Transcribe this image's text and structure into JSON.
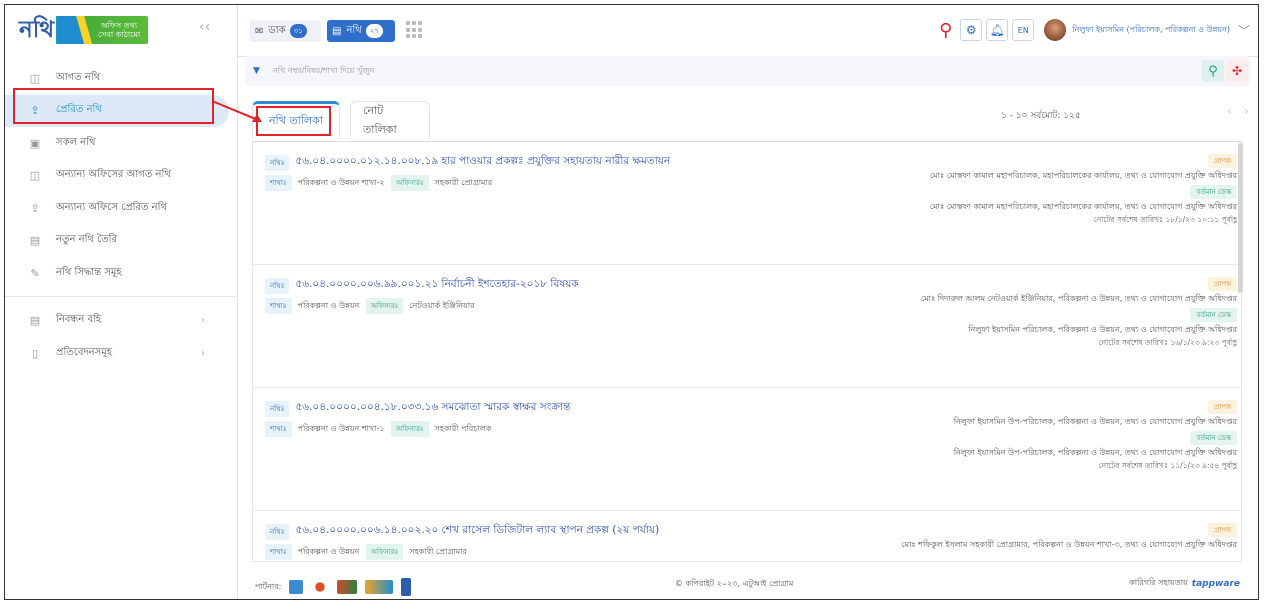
{
  "app": {
    "logo_main": "নথি",
    "logo_sub": "অফিস তথ্য\nসেবা কাঠামো",
    "collapse_icon": "chevrons-left-icon"
  },
  "sidebar": {
    "items": [
      {
        "label": "আগত নথি",
        "icon": "inbox-icon"
      },
      {
        "label": "প্রেরিত নথি",
        "icon": "upload-icon",
        "active": true
      },
      {
        "label": "সকল নথি",
        "icon": "briefcase-icon"
      },
      {
        "label": "অন্যান্য অফিসের আগত নথি",
        "icon": "inbox-icon"
      },
      {
        "label": "অন্যান্য অফিসে প্রেরিত নথি",
        "icon": "upload-icon"
      },
      {
        "label": "নতুন নথি তৈরি",
        "icon": "new-file-icon"
      },
      {
        "label": "নথি সিদ্ধান্ত সমূহ",
        "icon": "pin-icon"
      }
    ],
    "bottom_items": [
      {
        "label": "নিবন্ধন বহি",
        "icon": "register-icon"
      },
      {
        "label": "প্রতিবেদনসমূহ",
        "icon": "report-icon"
      }
    ]
  },
  "topbar": {
    "dak_label": "ডাক",
    "dak_count": "৩১",
    "nothi_label": "নথি",
    "nothi_count": "২৭",
    "lang_label": "EN",
    "user_name": "নিলুফা ইয়াসমিন (পরিচালক, পরিকল্পনা ও উন্নয়ন)"
  },
  "search": {
    "placeholder": "নথি নম্বর/বিষয়/শাখা দিয়ে খুঁজুন"
  },
  "tabs": [
    {
      "label": "নথি তালিকা",
      "active": true
    },
    {
      "label": "নোট তালিকা"
    }
  ],
  "pagination": {
    "text": "১ - ১০ সর্বমোট: ১২৫"
  },
  "labels": {
    "nothi_tag": "নথিঃ",
    "branch_tag": "শাখাঃ",
    "desk_tag": "অফিসারঃ",
    "sender_tag": "প্রাপক",
    "current_tag": "বর্তমান ডেস্ক"
  },
  "cards": [
    {
      "number": "৫৬.০৪.০০০০.০১২.১৪.০০৮.১৯",
      "subject": "হার পাওয়ার প্রকল্পঃ প্রযুক্তির সহায়তায় নারীর ক্ষমতায়ন",
      "branch": "পরিকল্পনা ও উন্নয়ন শাখা-২",
      "desk": "সহকারী প্রোগ্রামার",
      "receiver": "মোঃ মোস্তফা কামাল মহাপরিচালক, মহাপরিচালকের কার্যালয়, তথ্য ও যোগাযোগ প্রযুক্তি অধিদপ্তর",
      "current": "মোঃ মোস্তফা কামাল মহাপরিচালক, মহাপরিচালকের কার্যালয়, তথ্য ও যোগাযোগ প্রযুক্তি অধিদপ্তর",
      "last_date": "নোটের সর্বশেষ তারিখঃ ১৮/১/২৩ ১০:১১ পূর্বাহ্ণ"
    },
    {
      "number": "৫৬.০৪.০০০০.০০৬.৯৯.০০১.২১",
      "subject": "নির্বাচনী ইশতেহার-২০১৮ বিষয়ক",
      "branch": "পরিকল্পনা ও উন্নয়ন",
      "desk": "নেটওয়ার্ক ইঞ্জিনিয়ার",
      "receiver": "মোঃ দিদারুল আলম নেটওয়ার্ক ইঞ্জিনিয়ার, পরিকল্পনা ও উন্নয়ন, তথ্য ও যোগাযোগ প্রযুক্তি অধিদপ্তর",
      "current": "নিলুফা ইয়াসমিন পরিচালক, পরিকল্পনা ও উন্নয়ন, তথ্য ও যোগাযোগ প্রযুক্তি অধিদপ্তর",
      "last_date": "নোটের সর্বশেষ তারিখঃ ১৬/১/২৩ ৯:২৩ পূর্বাহ্ণ"
    },
    {
      "number": "৫৬.০৪.০০০০.০০৪.১৮.০৩৩.১৬",
      "subject": "সমঝোতা স্মারক স্বাক্ষর সংক্রান্ত",
      "branch": "পরিকল্পনা ও উন্নয়ন শাখা-১",
      "desk": "সহকারী পরিচালক",
      "receiver": "নিলুফা ইয়াসমিন উপ-পরিচালক, পরিকল্পনা ও উন্নয়ন, তথ্য ও যোগাযোগ প্রযুক্তি অধিদপ্তর",
      "current": "নিলুফা ইয়াসমিন উপ-পরিচালক, পরিকল্পনা ও উন্নয়ন, তথ্য ও যোগাযোগ প্রযুক্তি অধিদপ্তর",
      "last_date": "নোটের সর্বশেষ তারিখঃ ১১/১/২৩ ৯:৫৪ পূর্বাহ্ণ"
    },
    {
      "number": "৫৬.০৪.০০০০.০০৬.১৪.০০২.২০",
      "subject": "শেখ রাসেল ডিজিটাল ল্যাব স্থাপন প্রকল্প (২য় পর্যায়)",
      "branch": "পরিকল্পনা ও উন্নয়ন",
      "desk": "সহকারী প্রোগ্রামার",
      "receiver": "মোঃ শফিকুল ইসলাম সহকারী প্রোগ্রামার, পরিকল্পনা ও উন্নয়ন শাখা-৩, তথ্য ও যোগাযোগ প্রযুক্তি অধিদপ্তর",
      "current": "",
      "last_date": ""
    }
  ],
  "footer": {
    "partner_label": "পার্টনার:",
    "copyright": "© কপিরাইট ২০২৩, এটুআই প্রোগ্রাম",
    "tech_label": "কারিগরি সহায়তায়",
    "brand": "tappware"
  },
  "colors": {
    "accent": "#2f6fc9",
    "highlight_red": "#e32128",
    "active_bg": "#dde9f7"
  }
}
